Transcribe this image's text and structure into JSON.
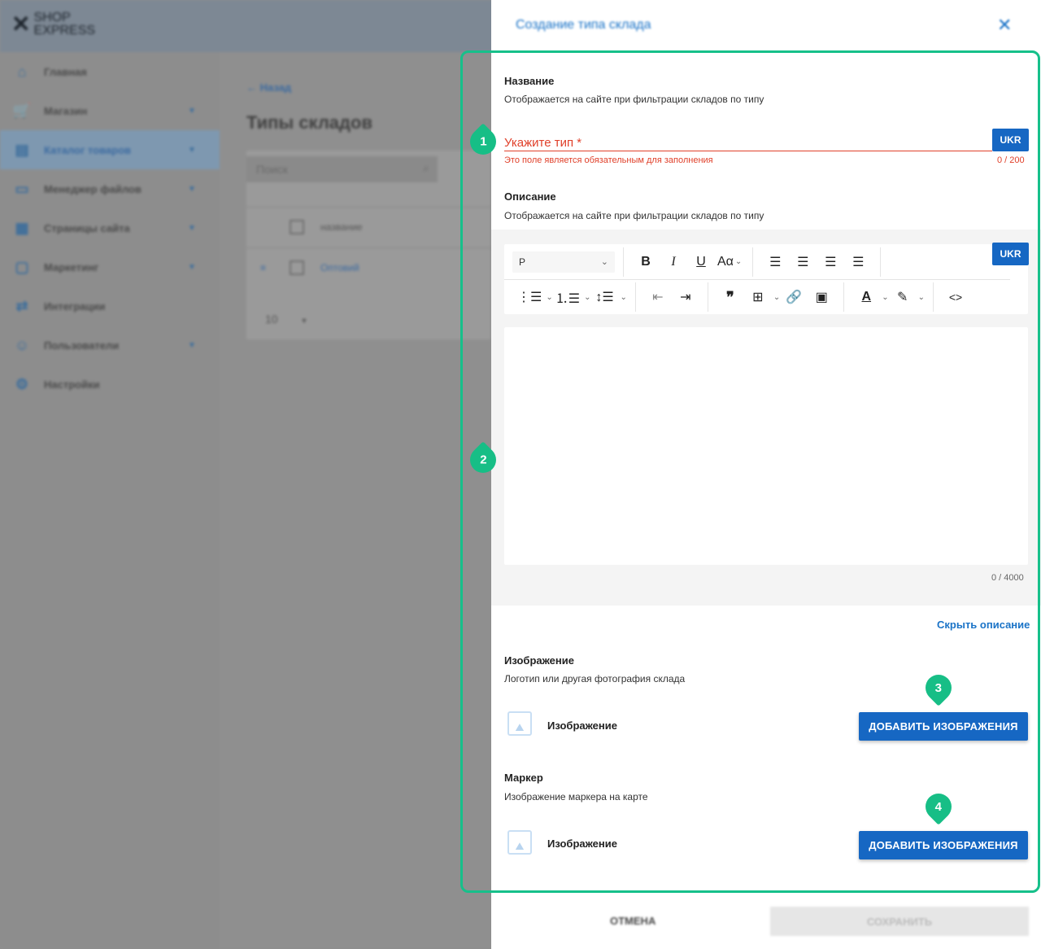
{
  "app": {
    "logo_line1": "SHOP",
    "logo_line2": "EXPRESS",
    "nav": [
      {
        "label": "Главная",
        "icon": "home-icon",
        "glyph": "⌂",
        "caret": false,
        "active": false
      },
      {
        "label": "Магазин",
        "icon": "cart-icon",
        "glyph": "🛒",
        "caret": true,
        "active": false
      },
      {
        "label": "Каталог товаров",
        "icon": "book-icon",
        "glyph": "▤",
        "caret": true,
        "active": true
      },
      {
        "label": "Менеджер файлов",
        "icon": "folder-icon",
        "glyph": "▭",
        "caret": true,
        "active": false
      },
      {
        "label": "Страницы сайта",
        "icon": "page-icon",
        "glyph": "▦",
        "caret": true,
        "active": false
      },
      {
        "label": "Маркетинг",
        "icon": "marketing-icon",
        "glyph": "▢",
        "caret": true,
        "active": false
      },
      {
        "label": "Интеграции",
        "icon": "integration-icon",
        "glyph": "⇄",
        "caret": false,
        "active": false
      },
      {
        "label": "Пользователи",
        "icon": "users-icon",
        "glyph": "☺",
        "caret": true,
        "active": false
      },
      {
        "label": "Настройки",
        "icon": "settings-icon",
        "glyph": "⚙",
        "caret": false,
        "active": false
      }
    ],
    "back_label": "Назад",
    "page_title": "Типы складов",
    "search_placeholder": "Поиск",
    "table_header": "название",
    "table_row": "Оптовий",
    "per_page": "10"
  },
  "drawer": {
    "title": "Создание типа склада",
    "name": {
      "label": "Название",
      "description": "Отображается на сайте при фильтрации складов по типу",
      "placeholder": "Укажите тип *",
      "value": "",
      "lang": "UKR",
      "error": "Это поле является обязательным для заполнения",
      "counter": "0 / 200"
    },
    "description": {
      "label": "Описание",
      "description": "Отображается на сайте при фильтрации складов по типу",
      "lang": "UKR",
      "format_value": "P",
      "counter": "0 / 4000",
      "hide_link": "Скрыть описание"
    },
    "toolbar": {
      "bold": "B",
      "italic": "I",
      "underline": "U",
      "font_size": "Aα",
      "quote": "❞",
      "code": "<>"
    },
    "image": {
      "label": "Изображение",
      "description": "Логотип или другая фотография склада",
      "placeholder_label": "Изображение",
      "button": "ДОБАВИТЬ ИЗОБРАЖЕНИЯ"
    },
    "marker": {
      "label": "Маркер",
      "description": "Изображение маркера на карте",
      "placeholder_label": "Изображение",
      "button": "ДОБАВИТЬ ИЗОБРАЖЕНИЯ"
    },
    "footer": {
      "cancel": "ОТМЕНА",
      "save": "СОХРАНИТЬ"
    }
  },
  "annotations": {
    "m1": "1",
    "m2": "2",
    "m3": "3",
    "m4": "4",
    "color": "#17be86"
  },
  "colors": {
    "accent": "#1667c3",
    "error": "#e0402a",
    "link": "#1a73c7"
  }
}
